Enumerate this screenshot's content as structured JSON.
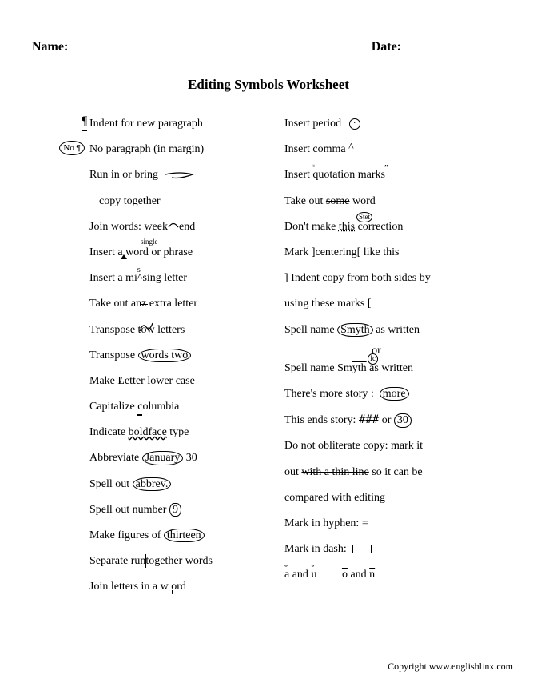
{
  "header": {
    "name_label": "Name:",
    "date_label": "Date:"
  },
  "title": "Editing Symbols Worksheet",
  "left_col": [
    "Indent for new paragraph",
    "No paragraph (in margin)",
    "Run in or bring",
    "copy together",
    "Join words: week  end",
    "Insert a word or phrase",
    "Insert a mising letter",
    "Take out anz extra letter",
    "Transpose tow letters",
    "Transpose words two",
    "Make Letter lower case",
    "Capitalize columbia",
    "Indicate boldface type",
    "Abbreviate January 30",
    "Spell out abbrev.",
    "Spell out number 9",
    "Make figures of thirteen",
    "Separate runtogether words",
    "Join letters in a w ord"
  ],
  "right_col": [
    "Insert period",
    "Insert comma",
    "Insert quotation marks",
    "Take out some word",
    "Don't make this correction",
    "Mark ]centering[ like this",
    "] Indent copy from both sides by",
    "using these marks [",
    "Spell name Smyth as written",
    "or",
    "Spell name Smyth as written",
    "There's more story :",
    "This ends story: ### or 30",
    "Do not obliterate copy: mark it",
    "out with a thin line so it can be",
    "compared with editing",
    "Mark in hyphen: =",
    "Mark in dash:",
    "a and u          o and n"
  ],
  "annotations": {
    "no_pilcrow": "No ¶",
    "single": "single",
    "s_letter": "s",
    "stet": "Stet",
    "fc": "fc",
    "more": "more",
    "period_dot": "·"
  },
  "copyright": "Copyright www.englishlinx.com"
}
